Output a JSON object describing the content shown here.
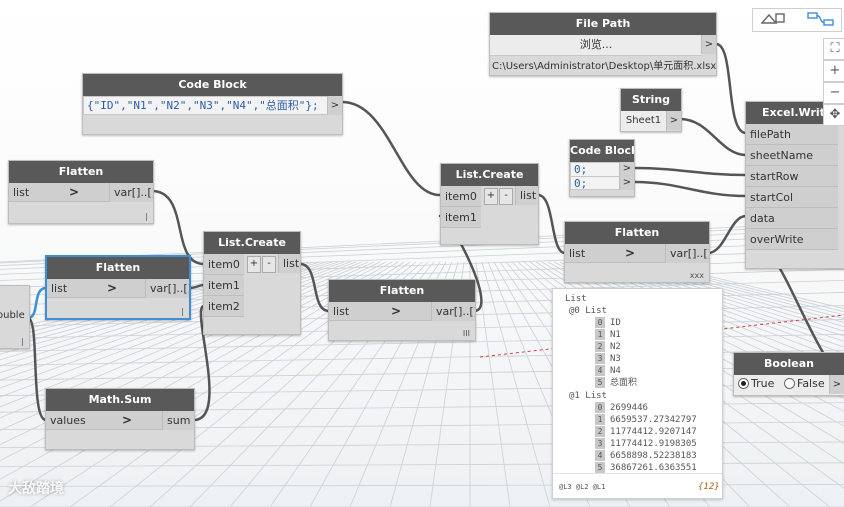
{
  "nodes": {
    "file_path": {
      "title": "File Path",
      "button": "浏览...",
      "out_arrow": ">",
      "value": "C:\\Users\\Administrator\\Desktop\\单元面积.xlsx"
    },
    "code_block_1": {
      "title": "Code Block",
      "code": "{\"ID\",\"N1\",\"N2\",\"N3\",\"N4\",\"总面积\"};",
      "out_arrow": ">"
    },
    "string": {
      "title": "String",
      "value": "Sheet1",
      "out_arrow": ">"
    },
    "code_block_2": {
      "title": "Code Block",
      "line1": "0;",
      "line2": "0;",
      "out_arrow": ">"
    },
    "excel_write": {
      "title": "Excel.Write",
      "inputs": [
        "filePath",
        "sheetName",
        "startRow",
        "startCol",
        "data",
        "overWrite"
      ]
    },
    "flatten_1": {
      "title": "Flatten",
      "in": "list",
      "arrow": ">",
      "out": "var[]..[]",
      "lace": "|"
    },
    "flatten_2": {
      "title": "Flatten",
      "in": "list",
      "arrow": ">",
      "out": "var[]..[]",
      "lace": "|"
    },
    "flatten_3": {
      "title": "Flatten",
      "in": "list",
      "arrow": ">",
      "out": "var[]..[]",
      "lace": "III"
    },
    "flatten_4": {
      "title": "Flatten",
      "in": "list",
      "arrow": ">",
      "out": "var[]..[]",
      "lace": "xxx"
    },
    "list_create_1": {
      "title": "List.Create",
      "inputs": [
        "item0",
        "item1",
        "item2"
      ],
      "plus": "+",
      "minus": "-",
      "out": "list"
    },
    "list_create_2": {
      "title": "List.Create",
      "inputs": [
        "item0",
        "item1"
      ],
      "plus": "+",
      "minus": "-",
      "out": "list"
    },
    "math_sum": {
      "title": "Math.Sum",
      "in": "values",
      "arrow": ">",
      "out": "sum"
    },
    "partial_node": {
      "in": "ouble",
      "lace": "|"
    },
    "boolean": {
      "title": "Boolean",
      "true_label": "True",
      "false_label": "False",
      "out_arrow": ">"
    }
  },
  "watch": {
    "root": "List",
    "groups": [
      {
        "label": "@0 List",
        "items": [
          {
            "idx": "0",
            "val": "ID"
          },
          {
            "idx": "1",
            "val": "N1"
          },
          {
            "idx": "2",
            "val": "N2"
          },
          {
            "idx": "3",
            "val": "N3"
          },
          {
            "idx": "4",
            "val": "N4"
          },
          {
            "idx": "5",
            "val": "总面积"
          }
        ]
      },
      {
        "label": "@1 List",
        "items": [
          {
            "idx": "0",
            "val": "2699446"
          },
          {
            "idx": "1",
            "val": "6659537.27342797"
          },
          {
            "idx": "2",
            "val": "11774412.9207147"
          },
          {
            "idx": "3",
            "val": "11774412.9198305"
          },
          {
            "idx": "4",
            "val": "6658898.52238183"
          },
          {
            "idx": "5",
            "val": "36867261.6363551"
          }
        ]
      }
    ],
    "levels": "@L3 @L2 @L1",
    "count": "{12}"
  },
  "toolbar": {
    "zoom_fit": "⛶",
    "zoom_in": "+",
    "zoom_out": "−",
    "pan": "✥"
  },
  "watermark": "大敌踏境",
  "colors": {
    "node_header": "#595959",
    "node_body": "#d9d9d9",
    "selection": "#3e8ed6",
    "code_text": "#2b5ca8"
  }
}
